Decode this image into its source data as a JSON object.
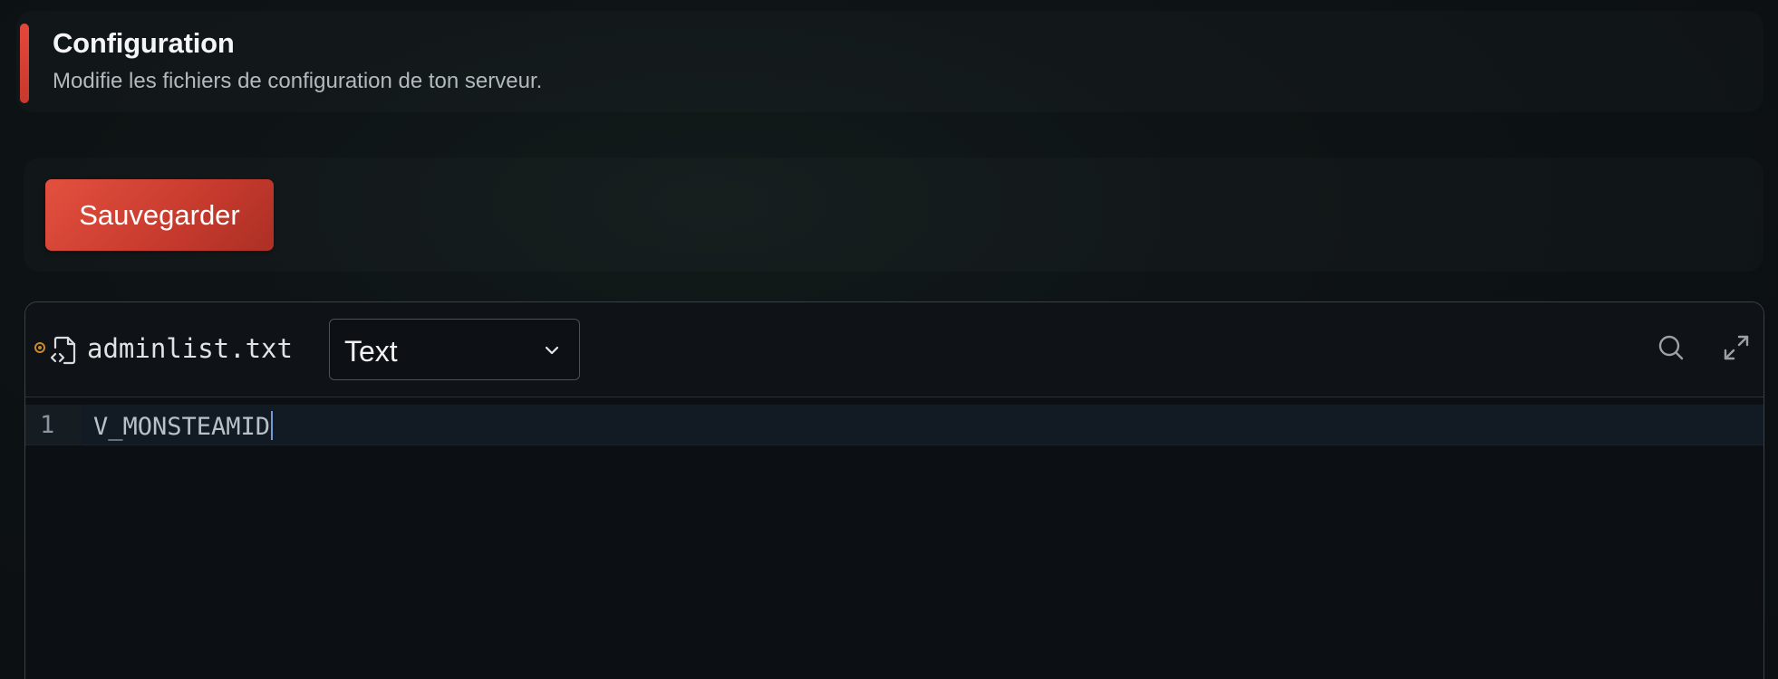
{
  "header": {
    "title": "Configuration",
    "subtitle": "Modifie les fichiers de configuration de ton serveur.",
    "accent_color": "#d9412f"
  },
  "toolbar": {
    "save_label": "Sauvegarder",
    "save_color": "#d4443a"
  },
  "editor": {
    "file_status_icon": "status-dot-icon",
    "file_icon": "code-file-icon",
    "file_name": "adminlist.txt",
    "language_select": {
      "selected": "Text"
    },
    "actions": [
      {
        "name": "search-icon"
      },
      {
        "name": "expand-icon"
      }
    ],
    "lines": [
      {
        "number": "1",
        "content": "V_MONSTEAMID"
      }
    ],
    "cursor_color": "#6f9bd8"
  }
}
